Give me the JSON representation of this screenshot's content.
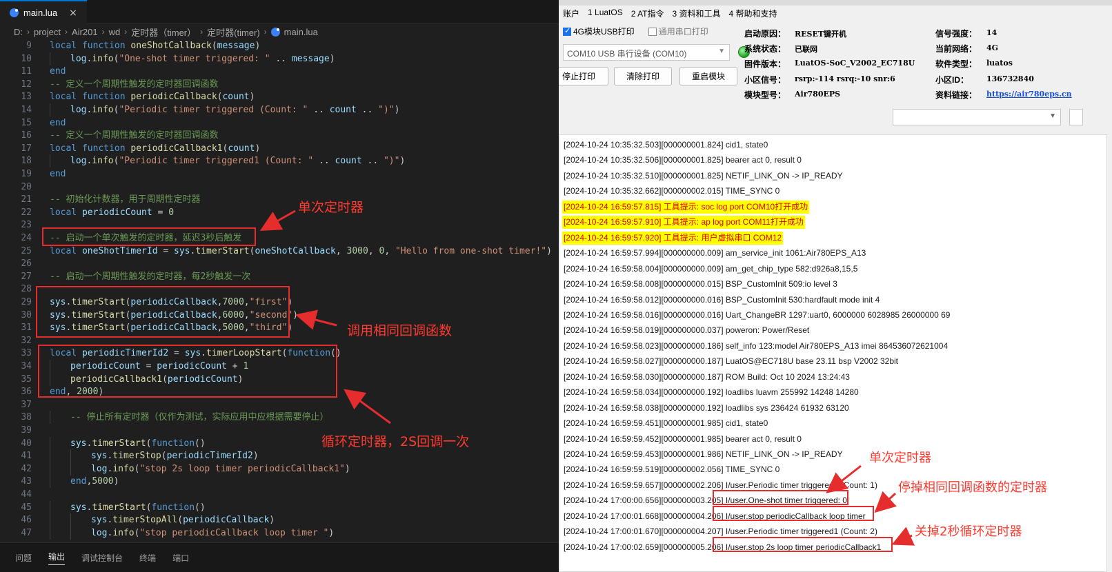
{
  "editor": {
    "tab": {
      "label": "main.lua",
      "close": "×"
    },
    "breadcrumb": [
      "D:",
      "project",
      "Air201",
      "wd",
      "定时器（timer）",
      "定时器(timer)",
      "main.lua"
    ],
    "lines": [
      {
        "n": "9",
        "indent": 0,
        "tokens": [
          [
            "kw",
            "local "
          ],
          [
            "kw",
            "function "
          ],
          [
            "fn",
            "oneShotCallback"
          ],
          [
            "",
            "("
          ],
          [
            "id",
            "message"
          ],
          [
            "",
            ")"
          ]
        ]
      },
      {
        "n": "10",
        "indent": 1,
        "tokens": [
          [
            "id",
            "log"
          ],
          [
            "",
            "."
          ],
          [
            "fn",
            "info"
          ],
          [
            "",
            "("
          ],
          [
            "str",
            "\"One-shot timer triggered: \""
          ],
          [
            "",
            " .. "
          ],
          [
            "id",
            "message"
          ],
          [
            "",
            ")"
          ]
        ]
      },
      {
        "n": "11",
        "indent": 0,
        "tokens": [
          [
            "kw",
            "end"
          ]
        ]
      },
      {
        "n": "12",
        "indent": 0,
        "tokens": [
          [
            "cm",
            "-- 定义一个周期性触发的定时器回调函数"
          ]
        ]
      },
      {
        "n": "13",
        "indent": 0,
        "tokens": [
          [
            "kw",
            "local "
          ],
          [
            "kw",
            "function "
          ],
          [
            "fn",
            "periodicCallback"
          ],
          [
            "",
            "("
          ],
          [
            "id",
            "count"
          ],
          [
            "",
            ")"
          ]
        ]
      },
      {
        "n": "14",
        "indent": 1,
        "tokens": [
          [
            "id",
            "log"
          ],
          [
            "",
            "."
          ],
          [
            "fn",
            "info"
          ],
          [
            "",
            "("
          ],
          [
            "str",
            "\"Periodic timer triggered (Count: \""
          ],
          [
            "",
            " .. "
          ],
          [
            "id",
            "count"
          ],
          [
            "",
            " .. "
          ],
          [
            "str",
            "\")\""
          ],
          [
            "",
            ")"
          ]
        ]
      },
      {
        "n": "15",
        "indent": 0,
        "tokens": [
          [
            "kw",
            "end"
          ]
        ]
      },
      {
        "n": "16",
        "indent": 0,
        "tokens": [
          [
            "cm",
            "-- 定义一个周期性触发的定时器回调函数"
          ]
        ]
      },
      {
        "n": "17",
        "indent": 0,
        "tokens": [
          [
            "kw",
            "local "
          ],
          [
            "kw",
            "function "
          ],
          [
            "fn",
            "periodicCallback1"
          ],
          [
            "",
            "("
          ],
          [
            "id",
            "count"
          ],
          [
            "",
            ")"
          ]
        ]
      },
      {
        "n": "18",
        "indent": 1,
        "tokens": [
          [
            "id",
            "log"
          ],
          [
            "",
            "."
          ],
          [
            "fn",
            "info"
          ],
          [
            "",
            "("
          ],
          [
            "str",
            "\"Periodic timer triggered1 (Count: \""
          ],
          [
            "",
            " .. "
          ],
          [
            "id",
            "count"
          ],
          [
            "",
            " .. "
          ],
          [
            "str",
            "\")\""
          ],
          [
            "",
            ")"
          ]
        ]
      },
      {
        "n": "19",
        "indent": 0,
        "tokens": [
          [
            "kw",
            "end"
          ]
        ]
      },
      {
        "n": "20",
        "indent": 0,
        "tokens": []
      },
      {
        "n": "21",
        "indent": 0,
        "tokens": [
          [
            "cm",
            "-- 初始化计数器，用于周期性定时器"
          ]
        ]
      },
      {
        "n": "22",
        "indent": 0,
        "tokens": [
          [
            "kw",
            "local "
          ],
          [
            "id",
            "periodicCount"
          ],
          [
            "",
            " = "
          ],
          [
            "num",
            "0"
          ]
        ]
      },
      {
        "n": "23",
        "indent": 0,
        "tokens": []
      },
      {
        "n": "24",
        "indent": 0,
        "tokens": [
          [
            "cm",
            "-- 启动一个单次触发的定时器，延迟3秒后触发"
          ]
        ]
      },
      {
        "n": "25",
        "indent": 0,
        "tokens": [
          [
            "kw",
            "local "
          ],
          [
            "id",
            "oneShotTimerId"
          ],
          [
            "",
            " = "
          ],
          [
            "id",
            "sys"
          ],
          [
            "",
            "."
          ],
          [
            "fn",
            "timerStart"
          ],
          [
            "",
            "("
          ],
          [
            "id",
            "oneShotCallback"
          ],
          [
            "",
            ", "
          ],
          [
            "num",
            "3000"
          ],
          [
            "",
            ", "
          ],
          [
            "num",
            "0"
          ],
          [
            "",
            ", "
          ],
          [
            "str",
            "\"Hello from one-shot timer!\""
          ],
          [
            "",
            ")"
          ]
        ]
      },
      {
        "n": "26",
        "indent": 0,
        "tokens": []
      },
      {
        "n": "27",
        "indent": 0,
        "tokens": [
          [
            "cm",
            "-- 启动一个周期性触发的定时器，每2秒触发一次"
          ]
        ]
      },
      {
        "n": "28",
        "indent": 0,
        "tokens": []
      },
      {
        "n": "29",
        "indent": 0,
        "tokens": [
          [
            "id",
            "sys"
          ],
          [
            "",
            "."
          ],
          [
            "fn",
            "timerStart"
          ],
          [
            "",
            "("
          ],
          [
            "id",
            "periodicCallback"
          ],
          [
            "",
            ","
          ],
          [
            "num",
            "7000"
          ],
          [
            "",
            ","
          ],
          [
            "str",
            "\"first\""
          ],
          [
            "",
            ")"
          ]
        ]
      },
      {
        "n": "30",
        "indent": 0,
        "tokens": [
          [
            "id",
            "sys"
          ],
          [
            "",
            "."
          ],
          [
            "fn",
            "timerStart"
          ],
          [
            "",
            "("
          ],
          [
            "id",
            "periodicCallback"
          ],
          [
            "",
            ","
          ],
          [
            "num",
            "6000"
          ],
          [
            "",
            ","
          ],
          [
            "str",
            "\"second\""
          ],
          [
            "",
            ")"
          ]
        ]
      },
      {
        "n": "31",
        "indent": 0,
        "tokens": [
          [
            "id",
            "sys"
          ],
          [
            "",
            "."
          ],
          [
            "fn",
            "timerStart"
          ],
          [
            "",
            "("
          ],
          [
            "id",
            "periodicCallback"
          ],
          [
            "",
            ","
          ],
          [
            "num",
            "5000"
          ],
          [
            "",
            ","
          ],
          [
            "str",
            "\"third\""
          ],
          [
            "",
            ")"
          ]
        ]
      },
      {
        "n": "32",
        "indent": 0,
        "tokens": []
      },
      {
        "n": "33",
        "indent": 0,
        "tokens": [
          [
            "kw",
            "local "
          ],
          [
            "id",
            "periodicTimerId2"
          ],
          [
            "",
            " = "
          ],
          [
            "id",
            "sys"
          ],
          [
            "",
            "."
          ],
          [
            "fn",
            "timerLoopStart"
          ],
          [
            "",
            "("
          ],
          [
            "kw",
            "function"
          ],
          [
            "",
            "()"
          ]
        ]
      },
      {
        "n": "34",
        "indent": 1,
        "tokens": [
          [
            "id",
            "periodicCount"
          ],
          [
            "",
            " = "
          ],
          [
            "id",
            "periodicCount"
          ],
          [
            "",
            " + "
          ],
          [
            "num",
            "1"
          ]
        ]
      },
      {
        "n": "35",
        "indent": 1,
        "tokens": [
          [
            "fn",
            "periodicCallback1"
          ],
          [
            "",
            "("
          ],
          [
            "id",
            "periodicCount"
          ],
          [
            "",
            ")"
          ]
        ]
      },
      {
        "n": "36",
        "indent": 0,
        "tokens": [
          [
            "kw",
            "end"
          ],
          [
            "",
            ", "
          ],
          [
            "num",
            "2000"
          ],
          [
            "",
            ")"
          ]
        ]
      },
      {
        "n": "37",
        "indent": 0,
        "tokens": []
      },
      {
        "n": "38",
        "indent": 1,
        "tokens": [
          [
            "cm",
            "-- 停止所有定时器（仅作为测试，实际应用中应根据需要停止）"
          ]
        ]
      },
      {
        "n": "39",
        "indent": 0,
        "tokens": []
      },
      {
        "n": "40",
        "indent": 1,
        "tokens": [
          [
            "id",
            "sys"
          ],
          [
            "",
            "."
          ],
          [
            "fn",
            "timerStart"
          ],
          [
            "",
            "("
          ],
          [
            "kw",
            "function"
          ],
          [
            "",
            "()"
          ]
        ]
      },
      {
        "n": "41",
        "indent": 2,
        "tokens": [
          [
            "id",
            "sys"
          ],
          [
            "",
            "."
          ],
          [
            "fn",
            "timerStop"
          ],
          [
            "",
            "("
          ],
          [
            "id",
            "periodicTimerId2"
          ],
          [
            "",
            ")"
          ]
        ]
      },
      {
        "n": "42",
        "indent": 2,
        "tokens": [
          [
            "id",
            "log"
          ],
          [
            "",
            "."
          ],
          [
            "fn",
            "info"
          ],
          [
            "",
            "("
          ],
          [
            "str",
            "\"stop 2s loop timer periodicCallback1\""
          ],
          [
            "",
            ")"
          ]
        ]
      },
      {
        "n": "43",
        "indent": 1,
        "tokens": [
          [
            "kw",
            "end"
          ],
          [
            "",
            ","
          ],
          [
            "num",
            "5000"
          ],
          [
            "",
            ")"
          ]
        ]
      },
      {
        "n": "44",
        "indent": 0,
        "tokens": []
      },
      {
        "n": "45",
        "indent": 1,
        "tokens": [
          [
            "id",
            "sys"
          ],
          [
            "",
            "."
          ],
          [
            "fn",
            "timerStart"
          ],
          [
            "",
            "("
          ],
          [
            "kw",
            "function"
          ],
          [
            "",
            "()"
          ]
        ]
      },
      {
        "n": "46",
        "indent": 2,
        "tokens": [
          [
            "id",
            "sys"
          ],
          [
            "",
            "."
          ],
          [
            "fn",
            "timerStopAll"
          ],
          [
            "",
            "("
          ],
          [
            "id",
            "periodicCallback"
          ],
          [
            "",
            ")"
          ]
        ]
      },
      {
        "n": "47",
        "indent": 2,
        "tokens": [
          [
            "id",
            "log"
          ],
          [
            "",
            "."
          ],
          [
            "fn",
            "info"
          ],
          [
            "",
            "("
          ],
          [
            "str",
            "\"stop periodicCallback loop timer \""
          ],
          [
            "",
            ")"
          ]
        ]
      }
    ],
    "annotations": {
      "single_timer": "单次定时器",
      "same_callback": "调用相同回调函数",
      "loop_timer": "循环定时器，2S回调一次"
    },
    "panel_tabs": [
      "问题",
      "输出",
      "调试控制台",
      "终端",
      "端口"
    ],
    "active_panel_tab": "输出"
  },
  "tool": {
    "menu": [
      "账户",
      "1 LuatOS",
      "2 AT指令",
      "3 资料和工具",
      "4 帮助和支持"
    ],
    "usb_print_label": "4G模块USB打印",
    "usb_print_checked": true,
    "serial_print_label": "通用串口打印",
    "serial_print_checked": false,
    "port": "COM10 USB 串行设备 (COM10)",
    "buttons": {
      "stop": "停止打印",
      "clear": "清除打印",
      "restart": "重启模块"
    },
    "info": {
      "boot_reason_label": "启动原因：",
      "boot_reason": "RESET键开机",
      "system_status_label": "系统状态：",
      "system_status": "已联网",
      "firmware_label": "固件版本：",
      "firmware": "LuatOS-SoC_V2002_EC718U",
      "cell_signal_label": "小区信号：",
      "cell_signal": "rsrp:-114 rsrq:-10 snr:6",
      "module_model_label": "模块型号：",
      "module_model": "Air780EPS",
      "signal_strength_label": "信号强度：",
      "signal_strength": "14",
      "current_network_label": "当前网络：",
      "current_network": "4G",
      "software_type_label": "软件类型：",
      "software_type": "luatos",
      "cell_id_label": "小区ID：",
      "cell_id": "136732840",
      "doc_link_label": "资料链接：",
      "doc_link": "https://air780eps.cn"
    },
    "log_lines": [
      {
        "text": "[2024-10-24 10:35:32.503][000000001.824] cid1, state0",
        "highlight": false
      },
      {
        "text": "[2024-10-24 10:35:32.506][000000001.825] bearer act 0, result 0",
        "highlight": false
      },
      {
        "text": "[2024-10-24 10:35:32.510][000000001.825] NETIF_LINK_ON -> IP_READY",
        "highlight": false
      },
      {
        "text": "[2024-10-24 10:35:32.662][000000002.015] TIME_SYNC 0",
        "highlight": false
      },
      {
        "text": "[2024-10-24 16:59:57.815] 工具提示: soc log port COM10打开成功",
        "highlight": true
      },
      {
        "text": "[2024-10-24 16:59:57.910] 工具提示: ap log port COM11打开成功",
        "highlight": true
      },
      {
        "text": "[2024-10-24 16:59:57.920] 工具提示: 用户虚拟串口 COM12",
        "highlight": true
      },
      {
        "text": "[2024-10-24 16:59:57.994][000000000.009] am_service_init 1061:Air780EPS_A13",
        "highlight": false
      },
      {
        "text": "[2024-10-24 16:59:58.004][000000000.009] am_get_chip_type 582:d926a8,15,5",
        "highlight": false
      },
      {
        "text": "[2024-10-24 16:59:58.008][000000000.015] BSP_CustomInit 509:io level 3",
        "highlight": false
      },
      {
        "text": "[2024-10-24 16:59:58.012][000000000.016] BSP_CustomInit 530:hardfault mode init 4",
        "highlight": false
      },
      {
        "text": "[2024-10-24 16:59:58.016][000000000.016] Uart_ChangeBR 1297:uart0, 6000000 6028985 26000000 69",
        "highlight": false
      },
      {
        "text": "[2024-10-24 16:59:58.019][000000000.037] poweron: Power/Reset",
        "highlight": false
      },
      {
        "text": "[2024-10-24 16:59:58.023][000000000.186] self_info 123:model Air780EPS_A13 imei 864536072621004",
        "highlight": false
      },
      {
        "text": "[2024-10-24 16:59:58.027][000000000.187] LuatOS@EC718U base 23.11 bsp V2002 32bit",
        "highlight": false
      },
      {
        "text": "[2024-10-24 16:59:58.030][000000000.187] ROM Build: Oct 10 2024 13:24:43",
        "highlight": false
      },
      {
        "text": "[2024-10-24 16:59:58.034][000000000.192] loadlibs luavm 255992 14248 14280",
        "highlight": false
      },
      {
        "text": "[2024-10-24 16:59:58.038][000000000.192] loadlibs sys   236424 61932 63120",
        "highlight": false
      },
      {
        "text": "[2024-10-24 16:59:59.451][000000001.985] cid1, state0",
        "highlight": false
      },
      {
        "text": "[2024-10-24 16:59:59.452][000000001.985] bearer act 0, result 0",
        "highlight": false
      },
      {
        "text": "[2024-10-24 16:59:59.453][000000001.986] NETIF_LINK_ON -> IP_READY",
        "highlight": false
      },
      {
        "text": "[2024-10-24 16:59:59.519][000000002.056] TIME_SYNC 0",
        "highlight": false
      },
      {
        "text": "[2024-10-24 16:59:59.657][000000002.206] I/user.Periodic timer triggered1 (Count: 1)",
        "highlight": false
      },
      {
        "text": "[2024-10-24 17:00:00.656][000000003.205] I/user.One-shot timer triggered: 0",
        "highlight": false
      },
      {
        "text": "[2024-10-24 17:00:01.668][000000004.206] I/user.stop periodicCallback loop timer",
        "highlight": false
      },
      {
        "text": "[2024-10-24 17:00:01.670][000000004.207] I/user.Periodic timer triggered1 (Count: 2)",
        "highlight": false
      },
      {
        "text": "[2024-10-24 17:00:02.659][000000005.206] I/user.stop 2s loop timer periodicCallback1",
        "highlight": false
      }
    ],
    "annotations": {
      "single_timer": "单次定时器",
      "stop_same_callback": "停掉相同回调函数的定时器",
      "stop_loop": "关掉2秒循环定时器"
    }
  },
  "colors": {
    "annotation_red": "#e52d2d",
    "log_highlight_bg": "#ffff00",
    "log_highlight_text": "#e00000"
  }
}
